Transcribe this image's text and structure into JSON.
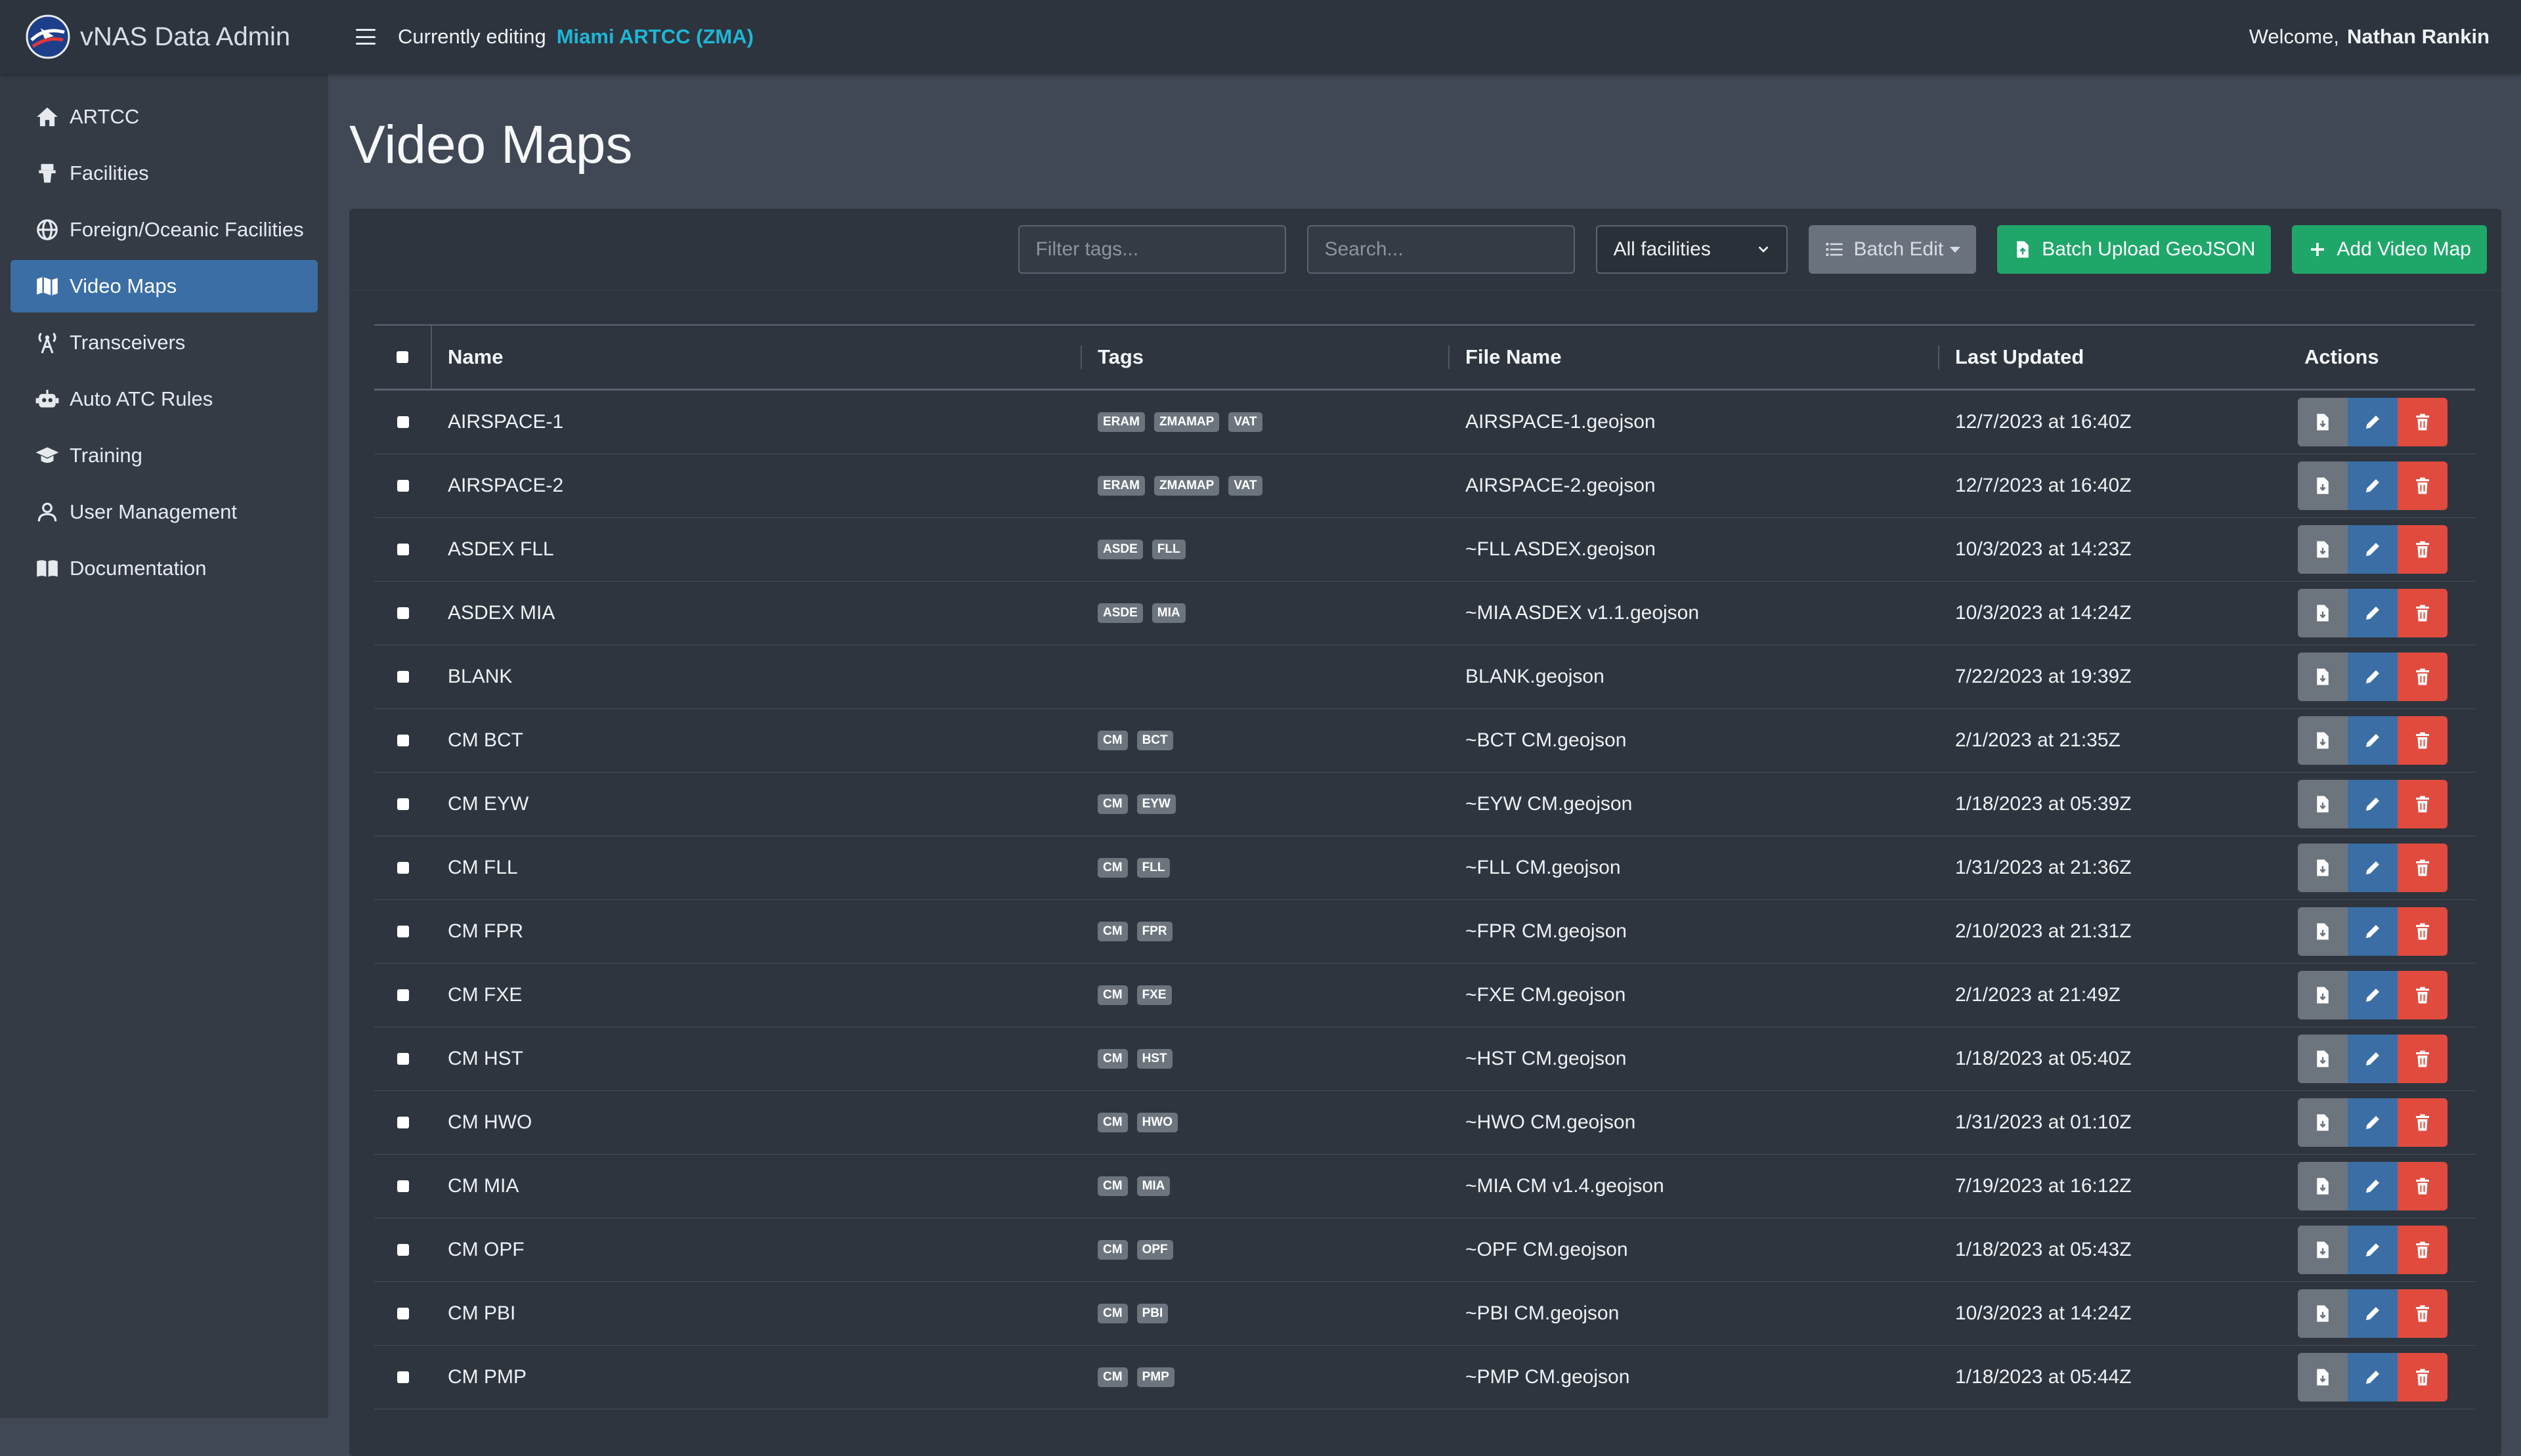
{
  "app": {
    "brand": "vNAS Data Admin",
    "editing_label": "Currently editing",
    "editing_org": "Miami ARTCC (ZMA)",
    "welcome_label": "Welcome,",
    "user_name": "Nathan Rankin"
  },
  "sidebar": {
    "items": [
      {
        "label": "ARTCC",
        "icon": "home-icon",
        "active": false
      },
      {
        "label": "Facilities",
        "icon": "tower-icon",
        "active": false
      },
      {
        "label": "Foreign/Oceanic Facilities",
        "icon": "globe-icon",
        "active": false
      },
      {
        "label": "Video Maps",
        "icon": "map-icon",
        "active": true
      },
      {
        "label": "Transceivers",
        "icon": "antenna-icon",
        "active": false
      },
      {
        "label": "Auto ATC Rules",
        "icon": "robot-icon",
        "active": false
      },
      {
        "label": "Training",
        "icon": "graduation-cap-icon",
        "active": false
      },
      {
        "label": "User Management",
        "icon": "user-icon",
        "active": false
      },
      {
        "label": "Documentation",
        "icon": "book-icon",
        "active": false
      }
    ]
  },
  "page": {
    "title": "Video Maps"
  },
  "toolbar": {
    "filter_placeholder": "Filter tags...",
    "search_placeholder": "Search...",
    "facility_select": "All facilities",
    "batch_edit_label": "Batch Edit",
    "batch_upload_label": "Batch Upload GeoJSON",
    "add_label": "Add Video Map"
  },
  "table": {
    "columns": [
      "Name",
      "Tags",
      "File Name",
      "Last Updated",
      "Actions"
    ],
    "rows": [
      {
        "name": "AIRSPACE-1",
        "tags": [
          "ERAM",
          "ZMAMAP",
          "VAT"
        ],
        "file": "AIRSPACE-1.geojson",
        "updated": "12/7/2023 at 16:40Z"
      },
      {
        "name": "AIRSPACE-2",
        "tags": [
          "ERAM",
          "ZMAMAP",
          "VAT"
        ],
        "file": "AIRSPACE-2.geojson",
        "updated": "12/7/2023 at 16:40Z"
      },
      {
        "name": "ASDEX FLL",
        "tags": [
          "ASDE",
          "FLL"
        ],
        "file": "~FLL ASDEX.geojson",
        "updated": "10/3/2023 at 14:23Z"
      },
      {
        "name": "ASDEX MIA",
        "tags": [
          "ASDE",
          "MIA"
        ],
        "file": "~MIA ASDEX v1.1.geojson",
        "updated": "10/3/2023 at 14:24Z"
      },
      {
        "name": "BLANK",
        "tags": [],
        "file": "BLANK.geojson",
        "updated": "7/22/2023 at 19:39Z"
      },
      {
        "name": "CM BCT",
        "tags": [
          "CM",
          "BCT"
        ],
        "file": "~BCT CM.geojson",
        "updated": "2/1/2023 at 21:35Z"
      },
      {
        "name": "CM EYW",
        "tags": [
          "CM",
          "EYW"
        ],
        "file": "~EYW CM.geojson",
        "updated": "1/18/2023 at 05:39Z"
      },
      {
        "name": "CM FLL",
        "tags": [
          "CM",
          "FLL"
        ],
        "file": "~FLL CM.geojson",
        "updated": "1/31/2023 at 21:36Z"
      },
      {
        "name": "CM FPR",
        "tags": [
          "CM",
          "FPR"
        ],
        "file": "~FPR CM.geojson",
        "updated": "2/10/2023 at 21:31Z"
      },
      {
        "name": "CM FXE",
        "tags": [
          "CM",
          "FXE"
        ],
        "file": "~FXE CM.geojson",
        "updated": "2/1/2023 at 21:49Z"
      },
      {
        "name": "CM HST",
        "tags": [
          "CM",
          "HST"
        ],
        "file": "~HST CM.geojson",
        "updated": "1/18/2023 at 05:40Z"
      },
      {
        "name": "CM HWO",
        "tags": [
          "CM",
          "HWO"
        ],
        "file": "~HWO CM.geojson",
        "updated": "1/31/2023 at 01:10Z"
      },
      {
        "name": "CM MIA",
        "tags": [
          "CM",
          "MIA"
        ],
        "file": "~MIA CM v1.4.geojson",
        "updated": "7/19/2023 at 16:12Z"
      },
      {
        "name": "CM OPF",
        "tags": [
          "CM",
          "OPF"
        ],
        "file": "~OPF CM.geojson",
        "updated": "1/18/2023 at 05:43Z"
      },
      {
        "name": "CM PBI",
        "tags": [
          "CM",
          "PBI"
        ],
        "file": "~PBI CM.geojson",
        "updated": "10/3/2023 at 14:24Z"
      },
      {
        "name": "CM PMP",
        "tags": [
          "CM",
          "PMP"
        ],
        "file": "~PMP CM.geojson",
        "updated": "1/18/2023 at 05:44Z"
      }
    ]
  },
  "colors": {
    "accent": "#3a6ea5",
    "link": "#1eb6d6",
    "success": "#1fa76a",
    "danger": "#e04b3d",
    "secondary": "#6c757d"
  }
}
